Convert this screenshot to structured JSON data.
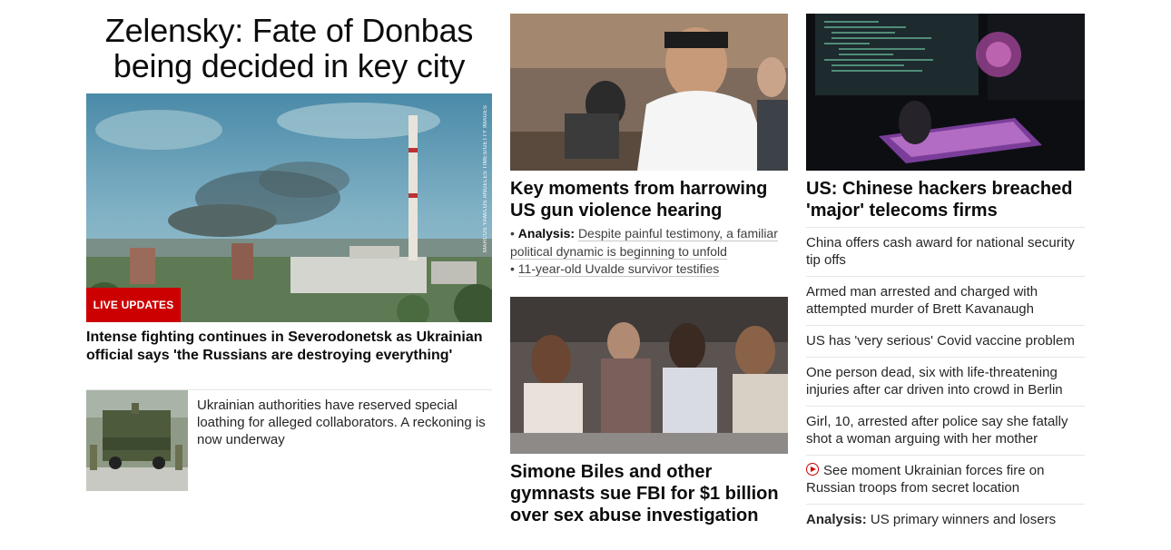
{
  "left": {
    "hero_title": "Zelensky: Fate of Donbas being decided in key city",
    "photo_credit": "MARCUS YAM/LOS ANGELES TIMES/GETTY IMAGES",
    "live_badge": "LIVE UPDATES",
    "lead_headline": "Intense fighting continues in Severodonetsk as Ukrainian official says 'the Russians are destroying everything'",
    "sub_story": "Ukrainian authorities have reserved special loathing for alleged collaborators. A reckoning is now underway"
  },
  "middle": {
    "story1_headline": "Key moments from harrowing US gun violence hearing",
    "story1_analysis_label": "Analysis:",
    "story1_analysis_text": "Despite painful testimony, a familiar political dynamic is beginning to unfold",
    "story1_link2": "11-year-old Uvalde survivor testifies",
    "story2_headline": "Simone Biles and other gymnasts sue FBI for $1 billion over sex abuse investigation"
  },
  "right": {
    "top_headline": "US: Chinese hackers breached 'major' telecoms firms",
    "items": [
      "China offers cash award for national security tip offs",
      "Armed man arrested and charged with attempted murder of Brett Kavanaugh",
      "US has 'very serious' Covid vaccine problem",
      "One person dead, six with life-threatening injuries after car driven into crowd in Berlin",
      "Girl, 10, arrested after police say she fatally shot a woman arguing with her mother",
      "See moment Ukrainian forces fire on Russian troops from secret location"
    ],
    "last_label": "Analysis:",
    "last_text": "US primary winners and losers"
  },
  "colors": {
    "brand_red": "#cc0000",
    "divider": "#e6e6e6"
  },
  "icons": {
    "video": "play-circle-icon"
  }
}
